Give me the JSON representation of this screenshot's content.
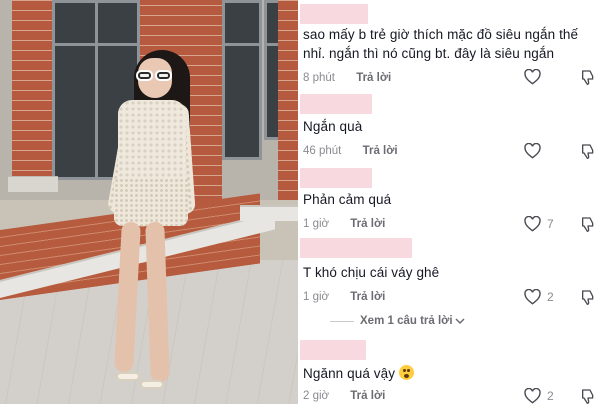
{
  "comments": [
    {
      "text_line1": "sao mấy b trẻ giờ thích mặc đồ siêu ngắn thế",
      "text_line2": "nhỉ. ngắn thì nó cũng bt. đây là siêu ngắn",
      "time": "8 phút",
      "reply_label": "Trả lời",
      "likes": ""
    },
    {
      "text_line1": "Ngắn quà",
      "time": "46 phút",
      "reply_label": "Trả lời",
      "likes": ""
    },
    {
      "text_line1": "Phản cảm quá",
      "time": "1 giờ",
      "reply_label": "Trả lời",
      "likes": "7"
    },
    {
      "text_line1": "T khó chịu cái váy ghê",
      "time": "1 giờ",
      "reply_label": "Trả lời",
      "likes": "2",
      "view_replies": "Xem 1 câu trả lời"
    },
    {
      "text_line1": "Ngănn quá vậy",
      "emoji": "astonished-face-emoji",
      "time": "2 giờ",
      "reply_label": "Trả lời",
      "likes": "2"
    }
  ],
  "icons": {
    "like": "heart-icon",
    "dislike": "thumbs-down-icon",
    "expand": "chevron-down-icon"
  },
  "colors": {
    "name_blur": "#f7d9df",
    "text": "#161823",
    "meta": "#8a8b91"
  }
}
